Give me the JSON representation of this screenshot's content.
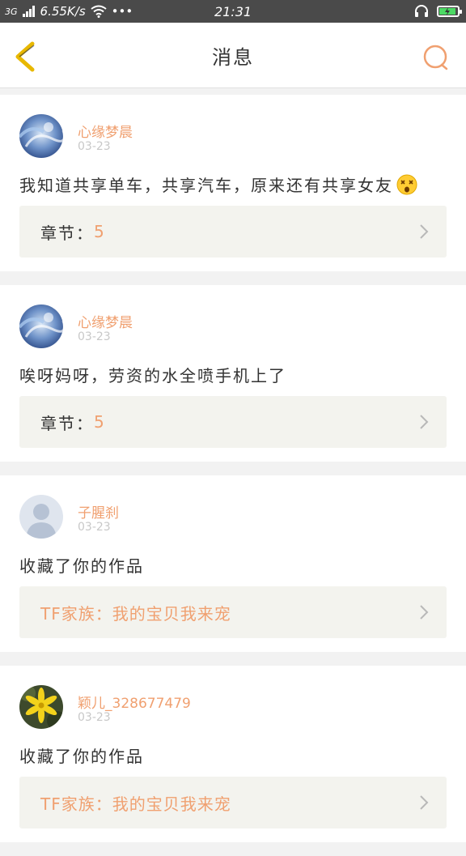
{
  "status_bar": {
    "network": "3G",
    "speed": "6.55K/s",
    "dots": "•••",
    "time": "21:31"
  },
  "header": {
    "title": "消息",
    "back_icon": "chevron-left-icon",
    "search_icon": "search-icon"
  },
  "colors": {
    "accent": "#f0a070",
    "back_icon": "#e8b800",
    "battery": "#4cd964"
  },
  "messages": [
    {
      "name": "心缘梦晨",
      "date": "03-23",
      "text": "我知道共享单车，共享汽车，原来还有共享女友",
      "emoji": "dizzy-face-emoji",
      "ref_label": "章节：",
      "ref_value": "5"
    },
    {
      "name": "心缘梦晨",
      "date": "03-23",
      "text": "唉呀妈呀，劳资的水全喷手机上了",
      "ref_label": "章节：",
      "ref_value": "5"
    },
    {
      "name": "子腥刹",
      "date": "03-23",
      "text": "收藏了你的作品",
      "ref_title": "TF家族：我的宝贝我来宠"
    },
    {
      "name": "颖儿_328677479",
      "date": "03-23",
      "text": "收藏了你的作品",
      "ref_title": "TF家族：我的宝贝我来宠"
    }
  ]
}
